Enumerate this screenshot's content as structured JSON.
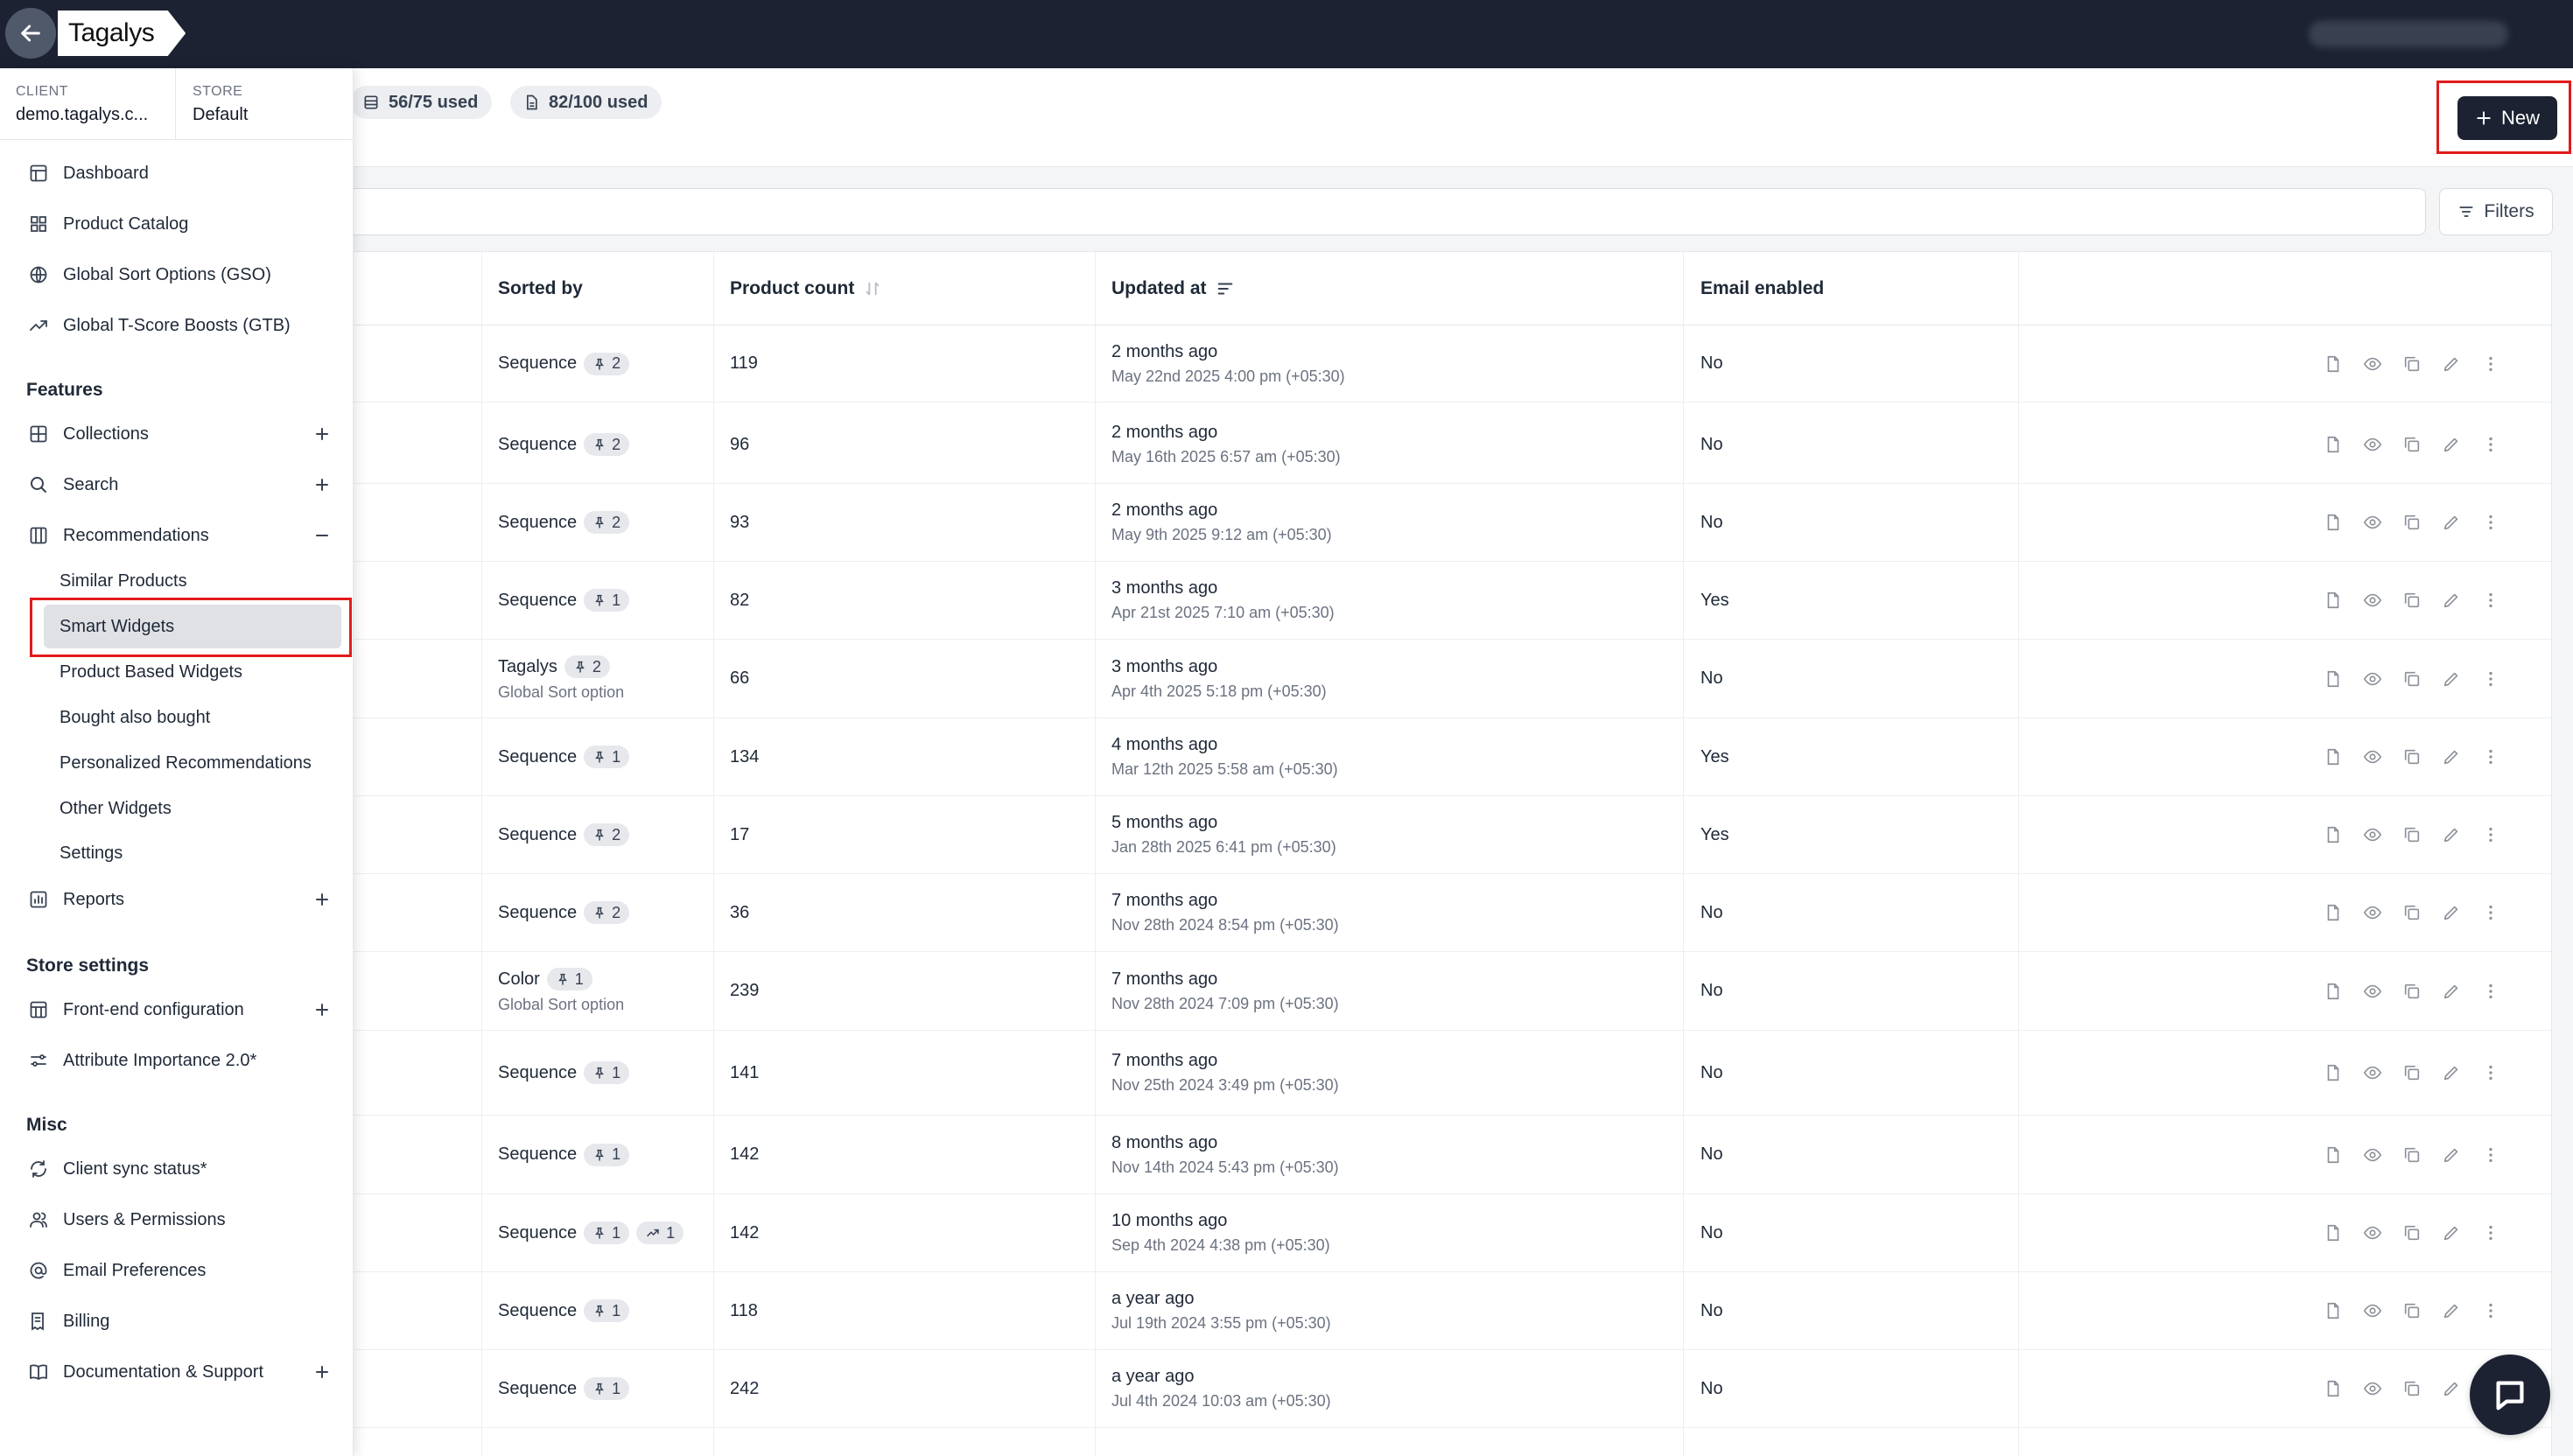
{
  "app": {
    "name": "Tagalys"
  },
  "context": {
    "client_label": "CLIENT",
    "client_value": "demo.tagalys.c...",
    "store_label": "STORE",
    "store_value": "Default"
  },
  "usage": {
    "widgets": "56/75 used",
    "pages": "82/100 used"
  },
  "actions": {
    "new_label": "New",
    "filters_label": "Filters"
  },
  "sidebar": {
    "top": [
      {
        "label": "Dashboard",
        "icon": "dashboard-icon"
      },
      {
        "label": "Product Catalog",
        "icon": "grid-icon"
      },
      {
        "label": "Global Sort Options (GSO)",
        "icon": "globe-icon"
      },
      {
        "label": "Global T-Score Boosts (GTB)",
        "icon": "trend-icon"
      }
    ],
    "features_label": "Features",
    "features": [
      {
        "label": "Collections",
        "icon": "collections-icon",
        "toggle": "+"
      },
      {
        "label": "Search",
        "icon": "search-icon",
        "toggle": "+"
      },
      {
        "label": "Recommendations",
        "icon": "columns-icon",
        "toggle": "−"
      }
    ],
    "recommendations_sub": [
      "Similar Products",
      "Smart Widgets",
      "Product Based Widgets",
      "Bought also bought",
      "Personalized Recommendations",
      "Other Widgets",
      "Settings"
    ],
    "reports": {
      "label": "Reports",
      "icon": "reports-icon",
      "toggle": "+"
    },
    "store_settings_label": "Store settings",
    "store_settings": [
      {
        "label": "Front-end configuration",
        "icon": "frontend-icon",
        "toggle": "+"
      },
      {
        "label": "Attribute Importance 2.0*",
        "icon": "sliders-icon"
      }
    ],
    "misc_label": "Misc",
    "misc": [
      {
        "label": "Client sync status*",
        "icon": "sync-icon"
      },
      {
        "label": "Users & Permissions",
        "icon": "users-icon"
      },
      {
        "label": "Email Preferences",
        "icon": "at-icon"
      },
      {
        "label": "Billing",
        "icon": "billing-icon"
      },
      {
        "label": "Documentation & Support",
        "icon": "book-icon",
        "toggle": "+"
      }
    ]
  },
  "table": {
    "headers": {
      "sorted_by": "Sorted by",
      "product_count": "Product count",
      "updated_at": "Updated at",
      "email_enabled": "Email enabled"
    },
    "rows": [
      {
        "sorted_by": "Sequence",
        "pins": "2",
        "sub": "",
        "count": "119",
        "ago": "2 months ago",
        "date": "May 22nd 2025 4:00 pm (+05:30)",
        "email": "No"
      },
      {
        "sorted_by": "Sequence",
        "pins": "2",
        "sub": "",
        "count": "96",
        "ago": "2 months ago",
        "date": "May 16th 2025 6:57 am (+05:30)",
        "email": "No"
      },
      {
        "sorted_by": "Sequence",
        "pins": "2",
        "sub": "",
        "count": "93",
        "ago": "2 months ago",
        "date": "May 9th 2025 9:12 am (+05:30)",
        "email": "No"
      },
      {
        "sorted_by": "Sequence",
        "pins": "1",
        "sub": "",
        "count": "82",
        "ago": "3 months ago",
        "date": "Apr 21st 2025 7:10 am (+05:30)",
        "email": "Yes"
      },
      {
        "sorted_by": "Tagalys",
        "pins": "2",
        "sub": "Global Sort option",
        "count": "66",
        "ago": "3 months ago",
        "date": "Apr 4th 2025 5:18 pm (+05:30)",
        "email": "No"
      },
      {
        "sorted_by": "Sequence",
        "pins": "1",
        "sub": "",
        "count": "134",
        "ago": "4 months ago",
        "date": "Mar 12th 2025 5:58 am (+05:30)",
        "email": "Yes"
      },
      {
        "sorted_by": "Sequence",
        "pins": "2",
        "sub": "",
        "count": "17",
        "ago": "5 months ago",
        "date": "Jan 28th 2025 6:41 pm (+05:30)",
        "email": "Yes"
      },
      {
        "sorted_by": "Sequence",
        "pins": "2",
        "sub": "",
        "count": "36",
        "ago": "7 months ago",
        "date": "Nov 28th 2024 8:54 pm (+05:30)",
        "email": "No"
      },
      {
        "sorted_by": "Color",
        "pins": "1",
        "sub": "Global Sort option",
        "count": "239",
        "ago": "7 months ago",
        "date": "Nov 28th 2024 7:09 pm (+05:30)",
        "email": "No"
      },
      {
        "sorted_by": "Sequence",
        "pins": "1",
        "sub": "",
        "count": "141",
        "ago": "7 months ago",
        "date": "Nov 25th 2024 3:49 pm (+05:30)",
        "email": "No"
      },
      {
        "sorted_by": "Sequence",
        "pins": "1",
        "sub": "",
        "count": "142",
        "ago": "8 months ago",
        "date": "Nov 14th 2024 5:43 pm (+05:30)",
        "email": "No"
      },
      {
        "sorted_by": "Sequence",
        "pins": "1",
        "boosts": "1",
        "sub": "",
        "count": "142",
        "ago": "10 months ago",
        "date": "Sep 4th 2024 4:38 pm (+05:30)",
        "email": "No"
      },
      {
        "sorted_by": "Sequence",
        "pins": "1",
        "sub": "",
        "count": "118",
        "ago": "a year ago",
        "date": "Jul 19th 2024 3:55 pm (+05:30)",
        "email": "No"
      },
      {
        "sorted_by": "Sequence",
        "pins": "1",
        "sub": "",
        "count": "242",
        "ago": "a year ago",
        "date": "Jul 4th 2024 10:03 am (+05:30)",
        "email": "No"
      }
    ]
  },
  "colors": {
    "topbar": "#1c2231",
    "highlight": "#e21b1b",
    "active_item": "#dfe1e5"
  }
}
